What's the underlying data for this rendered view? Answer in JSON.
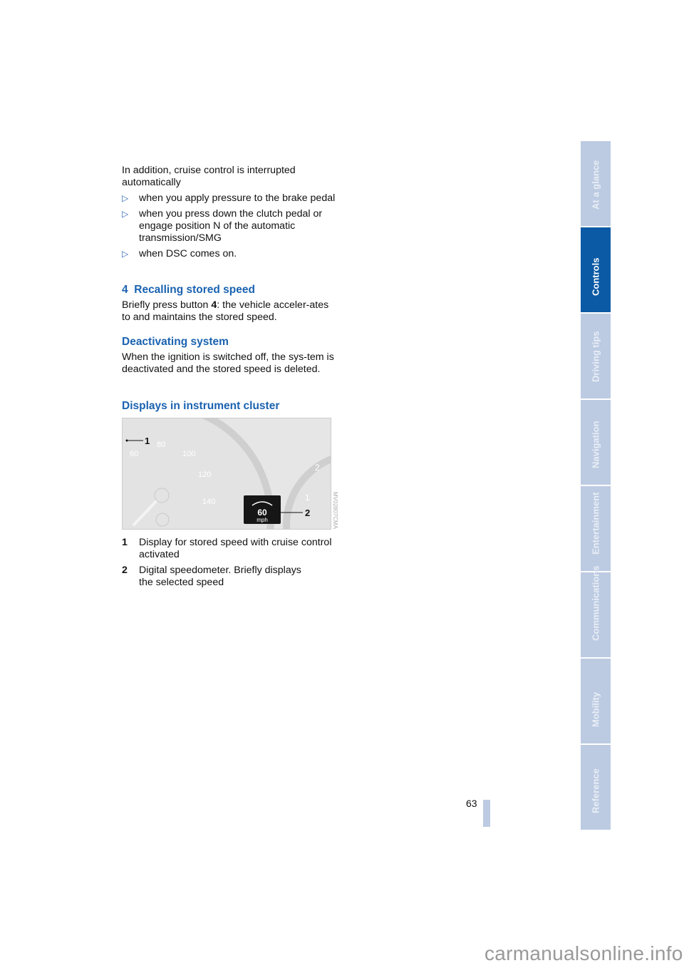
{
  "intro": "In addition, cruise control is interrupted automatically",
  "bullets": [
    "when you apply pressure to the brake pedal",
    "when you press down the clutch pedal or engage position N of the automatic transmission/SMG",
    "when DSC comes on."
  ],
  "bullet_marker": "▷",
  "sections": [
    {
      "number": "4",
      "title": "Recalling stored speed",
      "body_pre": "Briefly press button ",
      "body_bold": "4",
      "body_post": ": the vehicle acceler-ates to and maintains the stored speed."
    },
    {
      "title": "Deactivating system",
      "body": "When the ignition is switched off, the sys-tem is deactivated and the stored speed is deleted."
    },
    {
      "title": "Displays in instrument cluster"
    }
  ],
  "figure": {
    "speeds": [
      "60",
      "80",
      "100",
      "120",
      "140"
    ],
    "tach": [
      "2",
      "1"
    ],
    "display_value": "60",
    "display_unit": "mph",
    "callouts": [
      "1",
      "2"
    ],
    "code": "MV02807CMA"
  },
  "legend": [
    {
      "n": "1",
      "text": "Display for stored speed with cruise control activated"
    },
    {
      "n": "2",
      "text": "Digital speedometer. Briefly displays the selected speed"
    }
  ],
  "tabs": [
    {
      "label": "At a glance",
      "active": false
    },
    {
      "label": "Controls",
      "active": true
    },
    {
      "label": "Driving tips",
      "active": false
    },
    {
      "label": "Navigation",
      "active": false
    },
    {
      "label": "Entertainment",
      "active": false
    },
    {
      "label": "Communications",
      "active": false
    },
    {
      "label": "Mobility",
      "active": false
    },
    {
      "label": "Reference",
      "active": false
    }
  ],
  "page_number": "63",
  "watermark": "carmanualsonline.info",
  "colors": {
    "heading": "#1a62b0",
    "tab": "#bccbe2",
    "tab_active": "#0b5aa6"
  }
}
